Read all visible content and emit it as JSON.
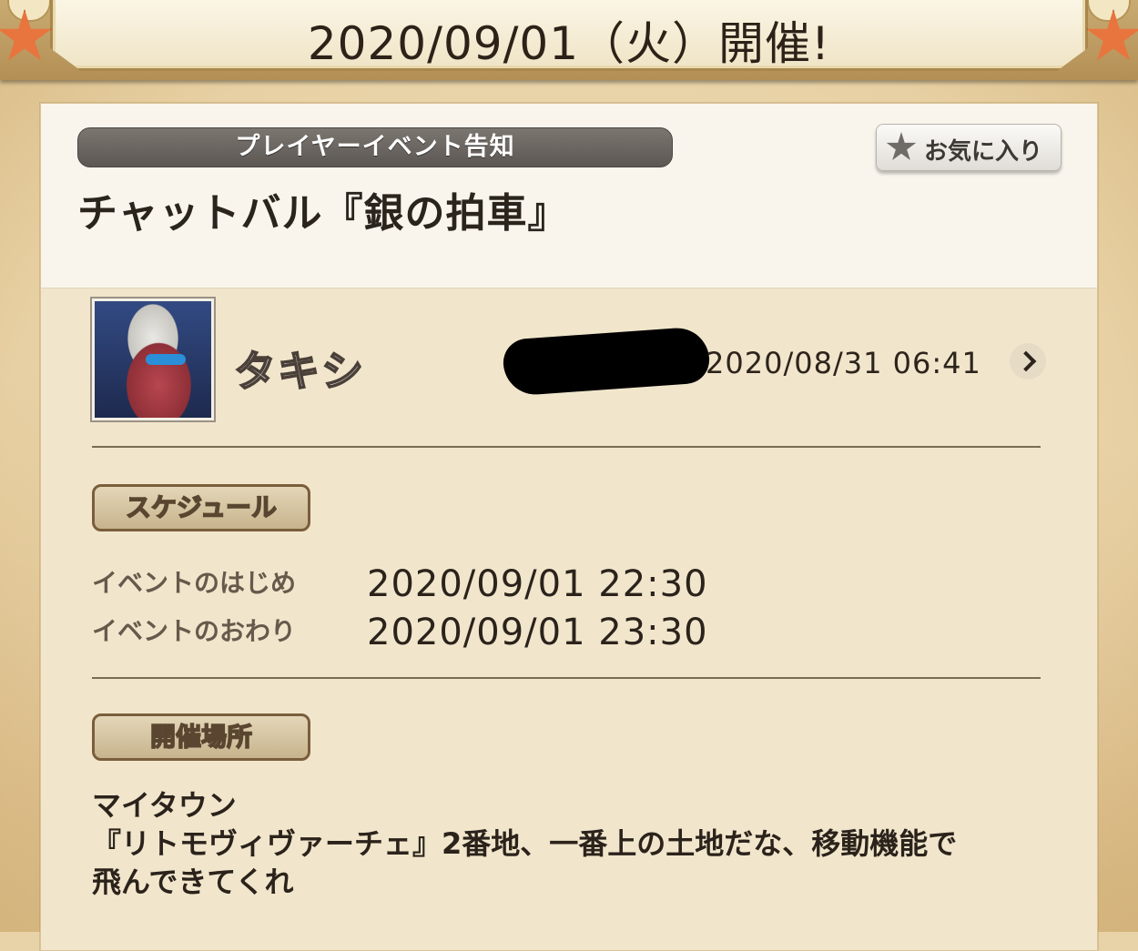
{
  "banner": {
    "title": "2020/09/01（火）開催!"
  },
  "card": {
    "category": "プレイヤーイベント告知",
    "favorite_label": "お気に入り",
    "title": "チャットバル『銀の拍車』"
  },
  "author": {
    "name": "タキシ",
    "posted_at": "2020/08/31  06:41"
  },
  "schedule": {
    "section_label": "スケジュール",
    "start_label": "イベントのはじめ",
    "start_value": "2020/09/01  22:30",
    "end_label": "イベントのおわり",
    "end_value": "2020/09/01  23:30"
  },
  "location": {
    "section_label": "開催場所",
    "lines": [
      "マイタウン",
      "『リトモヴィヴァーチェ』2番地、一番上の土地だな、移動機能で",
      "飛んできてくれ"
    ]
  },
  "colors": {
    "accent_star": "#e8743e",
    "category_bar": "#6a6561",
    "text_dark": "#2b231b"
  }
}
